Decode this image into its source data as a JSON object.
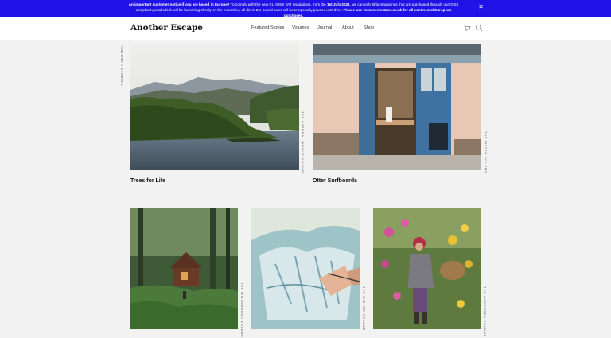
{
  "notice": {
    "bold_lead": "An important customer notice if you are based in Europe?",
    "text1": " To comply with the new EU IOSS VAT regulations, from the ",
    "bold_date": "1st July 2021",
    "text2": ", we can only ship magazines that are purchased through our IOSS compliant portal which will be launching shortly. In the meantime, all direct EU-bound sales will be temporarily paused until then. ",
    "bold_tail": "Please use www.newsstand.co.uk for all continental European purchases.",
    "close_icon": "close-icon"
  },
  "header": {
    "logo": "Another Escape",
    "nav": [
      "Featured Stories",
      "Volumes",
      "Journal",
      "About",
      "Shop"
    ],
    "icons": [
      "cart-icon",
      "search-icon"
    ]
  },
  "side_label": "Featured Stories",
  "stories": [
    {
      "title": "Trees for Life",
      "volume": "The Natural World Volume"
    },
    {
      "title": "Otter Surfboards",
      "volume": "The Water Volume"
    },
    {
      "title": "",
      "volume": "The Wilderness Volume"
    },
    {
      "title": "",
      "volume": "The Winter Volume"
    },
    {
      "title": "",
      "volume": "The Altitudes Volume"
    }
  ]
}
